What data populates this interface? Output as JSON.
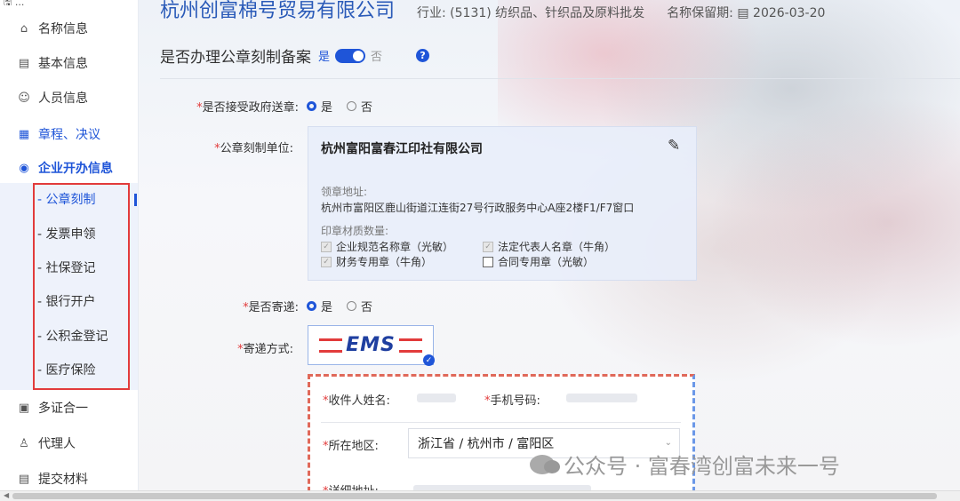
{
  "sidebar": {
    "top_snip": "🖫 ...",
    "items": [
      {
        "icon": "home-icon",
        "glyph": "⌂",
        "label": "名称信息"
      },
      {
        "icon": "list-icon",
        "glyph": "▤",
        "label": "基本信息"
      },
      {
        "icon": "people-icon",
        "glyph": "☺",
        "label": "人员信息"
      },
      {
        "icon": "document-icon",
        "glyph": "▦",
        "label": "章程、决议"
      },
      {
        "icon": "building-icon",
        "glyph": "◉",
        "label": "企业开办信息"
      },
      {
        "icon": "stack-icon",
        "glyph": "▣",
        "label": "多证合一"
      },
      {
        "icon": "agent-icon",
        "glyph": "♙",
        "label": "代理人"
      },
      {
        "icon": "submit-icon",
        "glyph": "▤",
        "label": "提交材料"
      }
    ],
    "sub_items": [
      {
        "label": "- 公章刻制"
      },
      {
        "label": "- 发票申领"
      },
      {
        "label": "- 社保登记"
      },
      {
        "label": "- 银行开户"
      },
      {
        "label": "- 公积金登记"
      },
      {
        "label": "- 医疗保险"
      }
    ]
  },
  "header": {
    "company_name": "杭州创富棉号贸易有限公司",
    "industry": "行业: (5131) 纺织品、针织品及原料批发",
    "reserve": "名称保留期: ▤ 2026-03-20"
  },
  "question": {
    "text": "是否办理公章刻制备案",
    "yes": "是",
    "no": "否",
    "help": "?"
  },
  "form": {
    "req_mark": "*",
    "gov_seal_label": "是否接受政府送章:",
    "gov_seal_yes": "是",
    "gov_seal_no": "否",
    "seal_unit_label": "公章刻制单位:",
    "mail_label": "是否寄递:",
    "mail_yes": "是",
    "mail_no": "否",
    "delivery_label": "寄递方式:"
  },
  "seal_card": {
    "company": "杭州富阳富春江印社有限公司",
    "edit_glyph": "✎",
    "pickup_label": "领章地址:",
    "pickup_address": "杭州市富阳区鹿山街道江连街27号行政服务中心A座2楼F1/F7窗口",
    "material_label": "印章材质数量:",
    "seals": [
      {
        "label": "企业规范名称章（光敏）",
        "checked": true
      },
      {
        "label": "法定代表人名章（牛角）",
        "checked": true
      },
      {
        "label": "财务专用章（牛角）",
        "checked": true
      },
      {
        "label": "合同专用章（光敏）",
        "checked": false
      }
    ]
  },
  "ems": {
    "logo": "EMS",
    "check": "✓"
  },
  "recipient": {
    "name_label": "收件人姓名:",
    "phone_label": "手机号码:",
    "region_label": "所在地区:",
    "region_value": "浙江省 / 杭州市 / 富阳区",
    "address_label": "详细地址:"
  },
  "watermark": "公众号 · 富春湾创富未来一号"
}
